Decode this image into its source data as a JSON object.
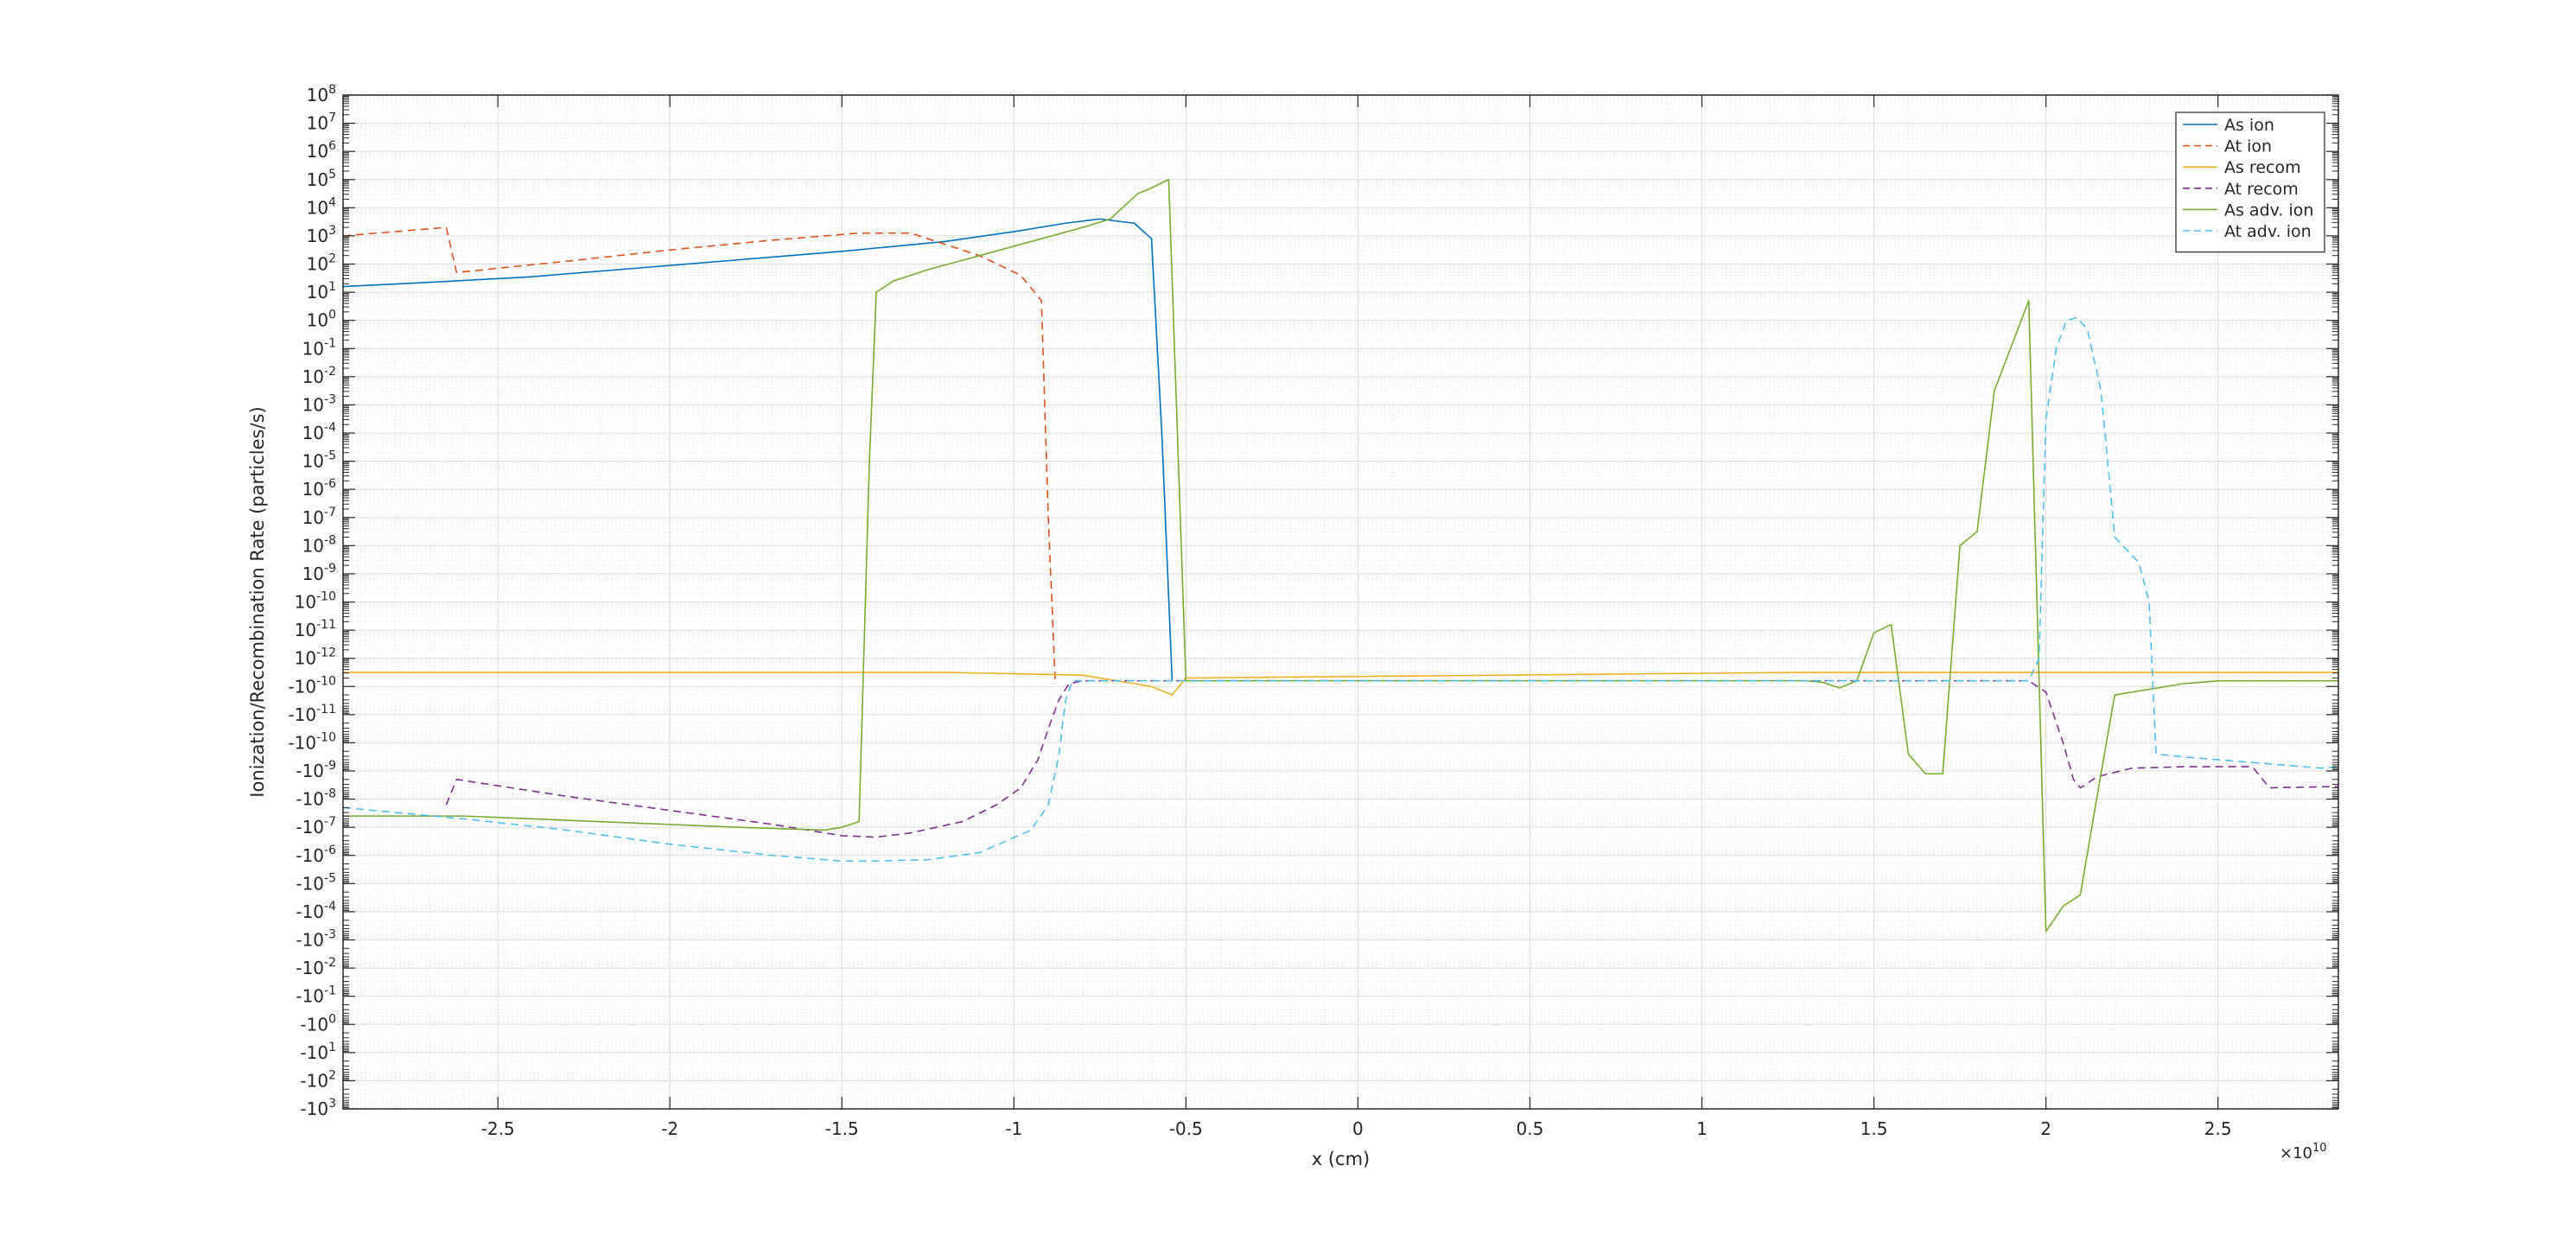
{
  "chart_data": {
    "type": "line",
    "title": "",
    "xlabel": "x (cm)",
    "ylabel": "Ionization/Recombination Rate (particles/s)",
    "x_multiplier_label": "×10",
    "x_multiplier_exponent": "10",
    "xlim": [
      -2.95,
      2.85
    ],
    "x_unit_scale": 10000000000.0,
    "x_ticks": [
      -2.5,
      -2,
      -1.5,
      -1,
      -0.5,
      0,
      0.5,
      1,
      1.5,
      2,
      2.5
    ],
    "x_tick_labels": [
      "-2.5",
      "-2",
      "-1.5",
      "-1",
      "-0.5",
      "0",
      "0.5",
      "1",
      "1.5",
      "2",
      "2.5"
    ],
    "y_scale": "symmetric-log",
    "y_tick_labels_pos": [
      {
        "base": "10",
        "exp": "8"
      },
      {
        "base": "10",
        "exp": "7"
      },
      {
        "base": "10",
        "exp": "6"
      },
      {
        "base": "10",
        "exp": "5"
      },
      {
        "base": "10",
        "exp": "4"
      },
      {
        "base": "10",
        "exp": "3"
      },
      {
        "base": "10",
        "exp": "2"
      },
      {
        "base": "10",
        "exp": "1"
      },
      {
        "base": "10",
        "exp": "0"
      },
      {
        "base": "10",
        "exp": "-1"
      },
      {
        "base": "10",
        "exp": "-2"
      },
      {
        "base": "10",
        "exp": "-3"
      },
      {
        "base": "10",
        "exp": "-4"
      },
      {
        "base": "10",
        "exp": "-5"
      },
      {
        "base": "10",
        "exp": "-6"
      },
      {
        "base": "10",
        "exp": "-7"
      },
      {
        "base": "10",
        "exp": "-8"
      },
      {
        "base": "10",
        "exp": "-9"
      },
      {
        "base": "10",
        "exp": "-10"
      },
      {
        "base": "10",
        "exp": "-11"
      },
      {
        "base": "10",
        "exp": "-12"
      }
    ],
    "y_tick_labels_neg": [
      {
        "base": "-10",
        "exp": "-10"
      },
      {
        "base": "-10",
        "exp": "-11"
      },
      {
        "base": "-10",
        "exp": "-10"
      },
      {
        "base": "-10",
        "exp": "-9"
      },
      {
        "base": "-10",
        "exp": "-8"
      },
      {
        "base": "-10",
        "exp": "-7"
      },
      {
        "base": "-10",
        "exp": "-6"
      },
      {
        "base": "-10",
        "exp": "-5"
      },
      {
        "base": "-10",
        "exp": "-4"
      },
      {
        "base": "-10",
        "exp": "-3"
      },
      {
        "base": "-10",
        "exp": "-2"
      },
      {
        "base": "-10",
        "exp": "-1"
      },
      {
        "base": "-10",
        "exp": "0"
      },
      {
        "base": "-10",
        "exp": "1"
      },
      {
        "base": "-10",
        "exp": "2"
      },
      {
        "base": "-10",
        "exp": "3"
      }
    ],
    "grid": true,
    "legend_position": "top-right",
    "series": [
      {
        "name": "As ion",
        "color": "#0072BD",
        "dash": "solid",
        "points": [
          [
            -2.95,
            1.2
          ],
          [
            -2.7,
            1.35
          ],
          [
            -2.4,
            1.55
          ],
          [
            -2.1,
            1.85
          ],
          [
            -1.8,
            2.15
          ],
          [
            -1.5,
            2.45
          ],
          [
            -1.2,
            2.8
          ],
          [
            -1.0,
            3.15
          ],
          [
            -0.85,
            3.45
          ],
          [
            -0.75,
            3.6
          ],
          [
            -0.65,
            3.45
          ],
          [
            -0.6,
            2.9
          ],
          [
            -0.57,
            -4.0
          ],
          [
            -0.54,
            -12.8
          ]
        ]
      },
      {
        "name": "At ion",
        "color": "#D95319",
        "dash": "dashed",
        "points": [
          [
            -2.95,
            3.0
          ],
          [
            -2.65,
            3.3
          ],
          [
            -2.62,
            1.7
          ],
          [
            -2.3,
            2.1
          ],
          [
            -2.0,
            2.5
          ],
          [
            -1.7,
            2.85
          ],
          [
            -1.45,
            3.1
          ],
          [
            -1.3,
            3.1
          ],
          [
            -1.1,
            2.3
          ],
          [
            -0.98,
            1.6
          ],
          [
            -0.92,
            0.7
          ],
          [
            -0.9,
            -7.0
          ],
          [
            -0.88,
            -12.8
          ]
        ]
      },
      {
        "name": "As recom",
        "color": "#EDB120",
        "dash": "solid",
        "points": [
          [
            -2.95,
            -12.5
          ],
          [
            -1.2,
            -12.5
          ],
          [
            -0.8,
            -12.6
          ],
          [
            -0.6,
            -13.0
          ],
          [
            -0.54,
            -13.3
          ],
          [
            -0.5,
            -12.7
          ],
          [
            1.3,
            -12.5
          ],
          [
            2.85,
            -12.5
          ]
        ]
      },
      {
        "name": "At recom",
        "color": "#7E2F8E",
        "dash": "dashed",
        "points": [
          [
            -2.65,
            -17.2
          ],
          [
            -2.62,
            -16.3
          ],
          [
            -2.3,
            -16.9
          ],
          [
            -2.0,
            -17.4
          ],
          [
            -1.7,
            -17.9
          ],
          [
            -1.5,
            -18.3
          ],
          [
            -1.4,
            -18.35
          ],
          [
            -1.3,
            -18.2
          ],
          [
            -1.15,
            -17.8
          ],
          [
            -1.05,
            -17.2
          ],
          [
            -0.98,
            -16.6
          ],
          [
            -0.93,
            -15.6
          ],
          [
            -0.9,
            -14.5
          ],
          [
            -0.87,
            -13.5
          ],
          [
            -0.84,
            -12.9
          ],
          [
            -0.8,
            -12.8
          ],
          [
            1.3,
            -12.8
          ],
          [
            1.95,
            -12.8
          ],
          [
            2.0,
            -13.2
          ],
          [
            2.05,
            -15.0
          ],
          [
            2.08,
            -16.3
          ],
          [
            2.1,
            -16.6
          ],
          [
            2.15,
            -16.2
          ],
          [
            2.25,
            -15.9
          ],
          [
            2.4,
            -15.85
          ],
          [
            2.6,
            -15.85
          ],
          [
            2.65,
            -16.6
          ],
          [
            2.85,
            -16.55
          ]
        ]
      },
      {
        "name": "As adv. ion",
        "color": "#77AC30",
        "dash": "solid",
        "points": [
          [
            -2.95,
            -17.6
          ],
          [
            -2.6,
            -17.6
          ],
          [
            -2.2,
            -17.8
          ],
          [
            -1.8,
            -18.0
          ],
          [
            -1.55,
            -18.1
          ],
          [
            -1.5,
            -18.0
          ],
          [
            -1.45,
            -17.8
          ],
          [
            -1.42,
            -5.0
          ],
          [
            -1.4,
            1.0
          ],
          [
            -1.35,
            1.4
          ],
          [
            -1.25,
            1.8
          ],
          [
            -1.1,
            2.3
          ],
          [
            -0.95,
            2.8
          ],
          [
            -0.8,
            3.3
          ],
          [
            -0.72,
            3.6
          ],
          [
            -0.64,
            4.5
          ],
          [
            -0.6,
            4.7
          ],
          [
            -0.55,
            5.0
          ],
          [
            -0.5,
            -12.8
          ],
          [
            1.3,
            -12.8
          ],
          [
            1.35,
            -12.85
          ],
          [
            1.4,
            -13.05
          ],
          [
            1.45,
            -12.8
          ],
          [
            1.5,
            -11.1
          ],
          [
            1.55,
            -10.8
          ],
          [
            1.6,
            -15.4
          ],
          [
            1.65,
            -16.1
          ],
          [
            1.7,
            -16.1
          ],
          [
            1.75,
            -8.0
          ],
          [
            1.8,
            -7.5
          ],
          [
            1.85,
            -2.5
          ],
          [
            1.95,
            0.7
          ],
          [
            2.0,
            -21.7
          ],
          [
            2.05,
            -20.8
          ],
          [
            2.1,
            -20.4
          ],
          [
            2.15,
            -16.8
          ],
          [
            2.2,
            -13.3
          ],
          [
            2.4,
            -12.9
          ],
          [
            2.5,
            -12.8
          ],
          [
            2.85,
            -12.8
          ]
        ]
      },
      {
        "name": "At adv. ion",
        "color": "#4DBEEE",
        "dash": "dashed",
        "points": [
          [
            -2.95,
            -17.3
          ],
          [
            -2.6,
            -17.7
          ],
          [
            -2.3,
            -18.1
          ],
          [
            -2.0,
            -18.6
          ],
          [
            -1.7,
            -19.0
          ],
          [
            -1.5,
            -19.2
          ],
          [
            -1.4,
            -19.2
          ],
          [
            -1.25,
            -19.15
          ],
          [
            -1.1,
            -18.9
          ],
          [
            -0.95,
            -18.1
          ],
          [
            -0.9,
            -17.2
          ],
          [
            -0.87,
            -15.5
          ],
          [
            -0.85,
            -13.5
          ],
          [
            -0.83,
            -12.8
          ],
          [
            1.3,
            -12.8
          ],
          [
            1.95,
            -12.8
          ],
          [
            1.98,
            -12.0
          ],
          [
            2.0,
            -3.5
          ],
          [
            2.03,
            -1.0
          ],
          [
            2.06,
            0.0
          ],
          [
            2.09,
            0.1
          ],
          [
            2.12,
            -0.3
          ],
          [
            2.16,
            -2.5
          ],
          [
            2.2,
            -7.7
          ],
          [
            2.27,
            -8.6
          ],
          [
            2.3,
            -10.0
          ],
          [
            2.32,
            -15.4
          ],
          [
            2.4,
            -15.5
          ],
          [
            2.6,
            -15.7
          ],
          [
            2.8,
            -15.9
          ],
          [
            2.85,
            -15.85
          ]
        ]
      }
    ]
  }
}
